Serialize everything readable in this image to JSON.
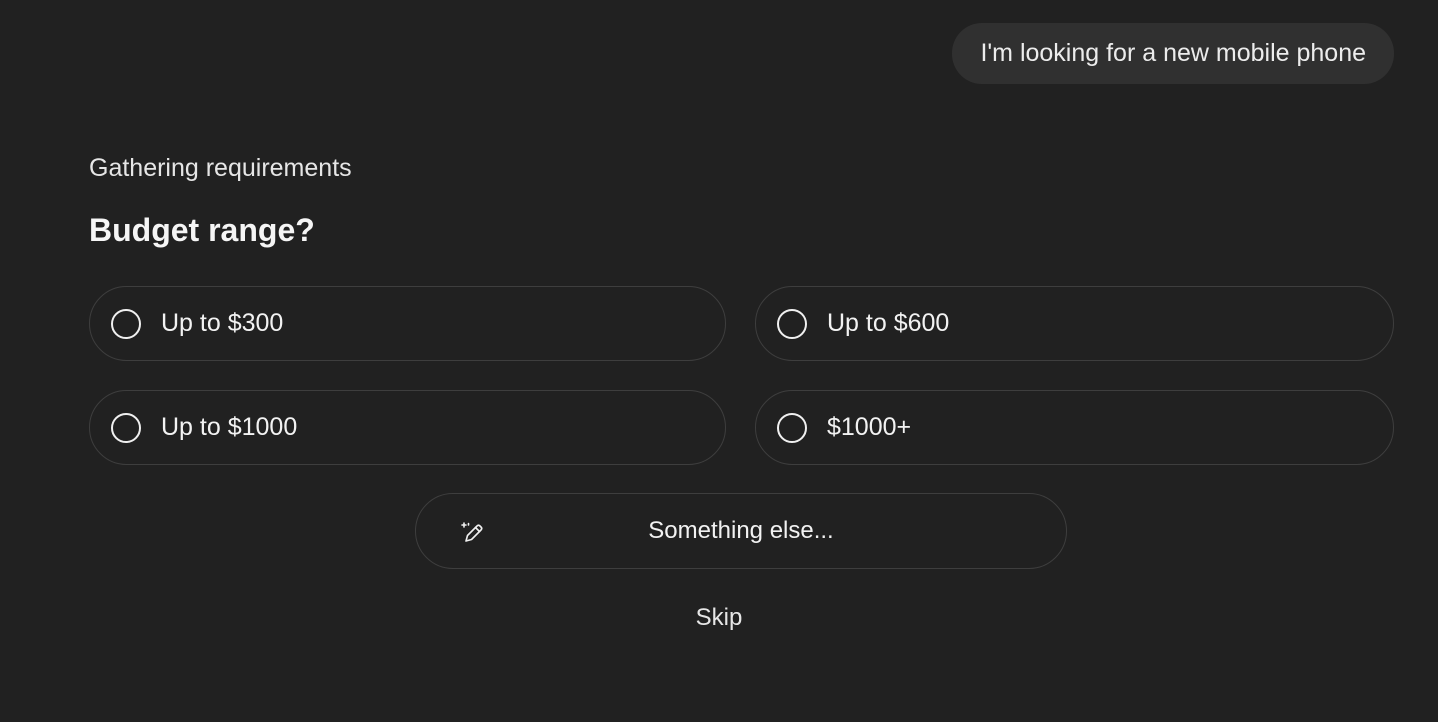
{
  "conversation": {
    "user_message": "I'm looking for a new mobile phone"
  },
  "questionnaire": {
    "section_label": "Gathering requirements",
    "question": "Budget range?",
    "options": [
      {
        "label": "Up to $300",
        "selected": false
      },
      {
        "label": "Up to $600",
        "selected": false
      },
      {
        "label": "Up to $1000",
        "selected": false
      },
      {
        "label": "$1000+",
        "selected": false
      }
    ],
    "something_else_label": "Something else...",
    "something_else_icon": "pencil-sparkle-icon",
    "skip_label": "Skip"
  },
  "colors": {
    "background": "#212121",
    "user_bubble": "#303030",
    "option_border": "#3e3e3e",
    "text": "#f2f2f2"
  }
}
